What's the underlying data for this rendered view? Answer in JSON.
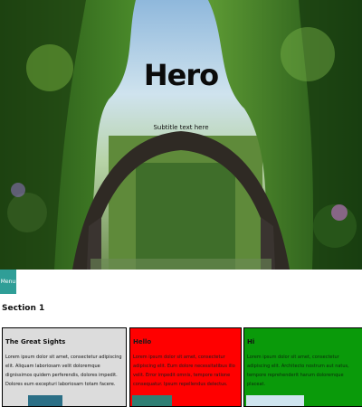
{
  "hero": {
    "title": "Hero",
    "subtitle": "Subtitle text here"
  },
  "menu": {
    "label": "Menu"
  },
  "section": {
    "title": "Section 1"
  },
  "cards": [
    {
      "title": "The Great Sights",
      "body": "Lorem ipsum dolor sit amet, consectetur adipiscing elit. Aliquam laboriosam velit doloremque dignissimos quidem perferendis, dolores impedit. Dolores eum excepturi laboriosam totam facere."
    },
    {
      "title": "Hello",
      "body": "Lorem ipsum dolor sit amet, consectetur adipiscing elit. Eum dolore necessitatibus illo velit. Error impedit omnis, tempore ratione consequatur. Ipsum repellendus delectus."
    },
    {
      "title": "Hi",
      "body": "Lorem ipsum dolor sit amet, consectetur adipiscing elit. Architecto nostrum aut natus, tempore reprehenderit harum doloremque placeat."
    }
  ],
  "colors": {
    "menu_bg": "#2f9e97",
    "card1_bg": "#dcdcdc",
    "card2_bg": "#ff0000",
    "card3_bg": "#0a9a0a"
  },
  "icons": {
    "hero_image": "forest-arch-bridge-photo"
  }
}
